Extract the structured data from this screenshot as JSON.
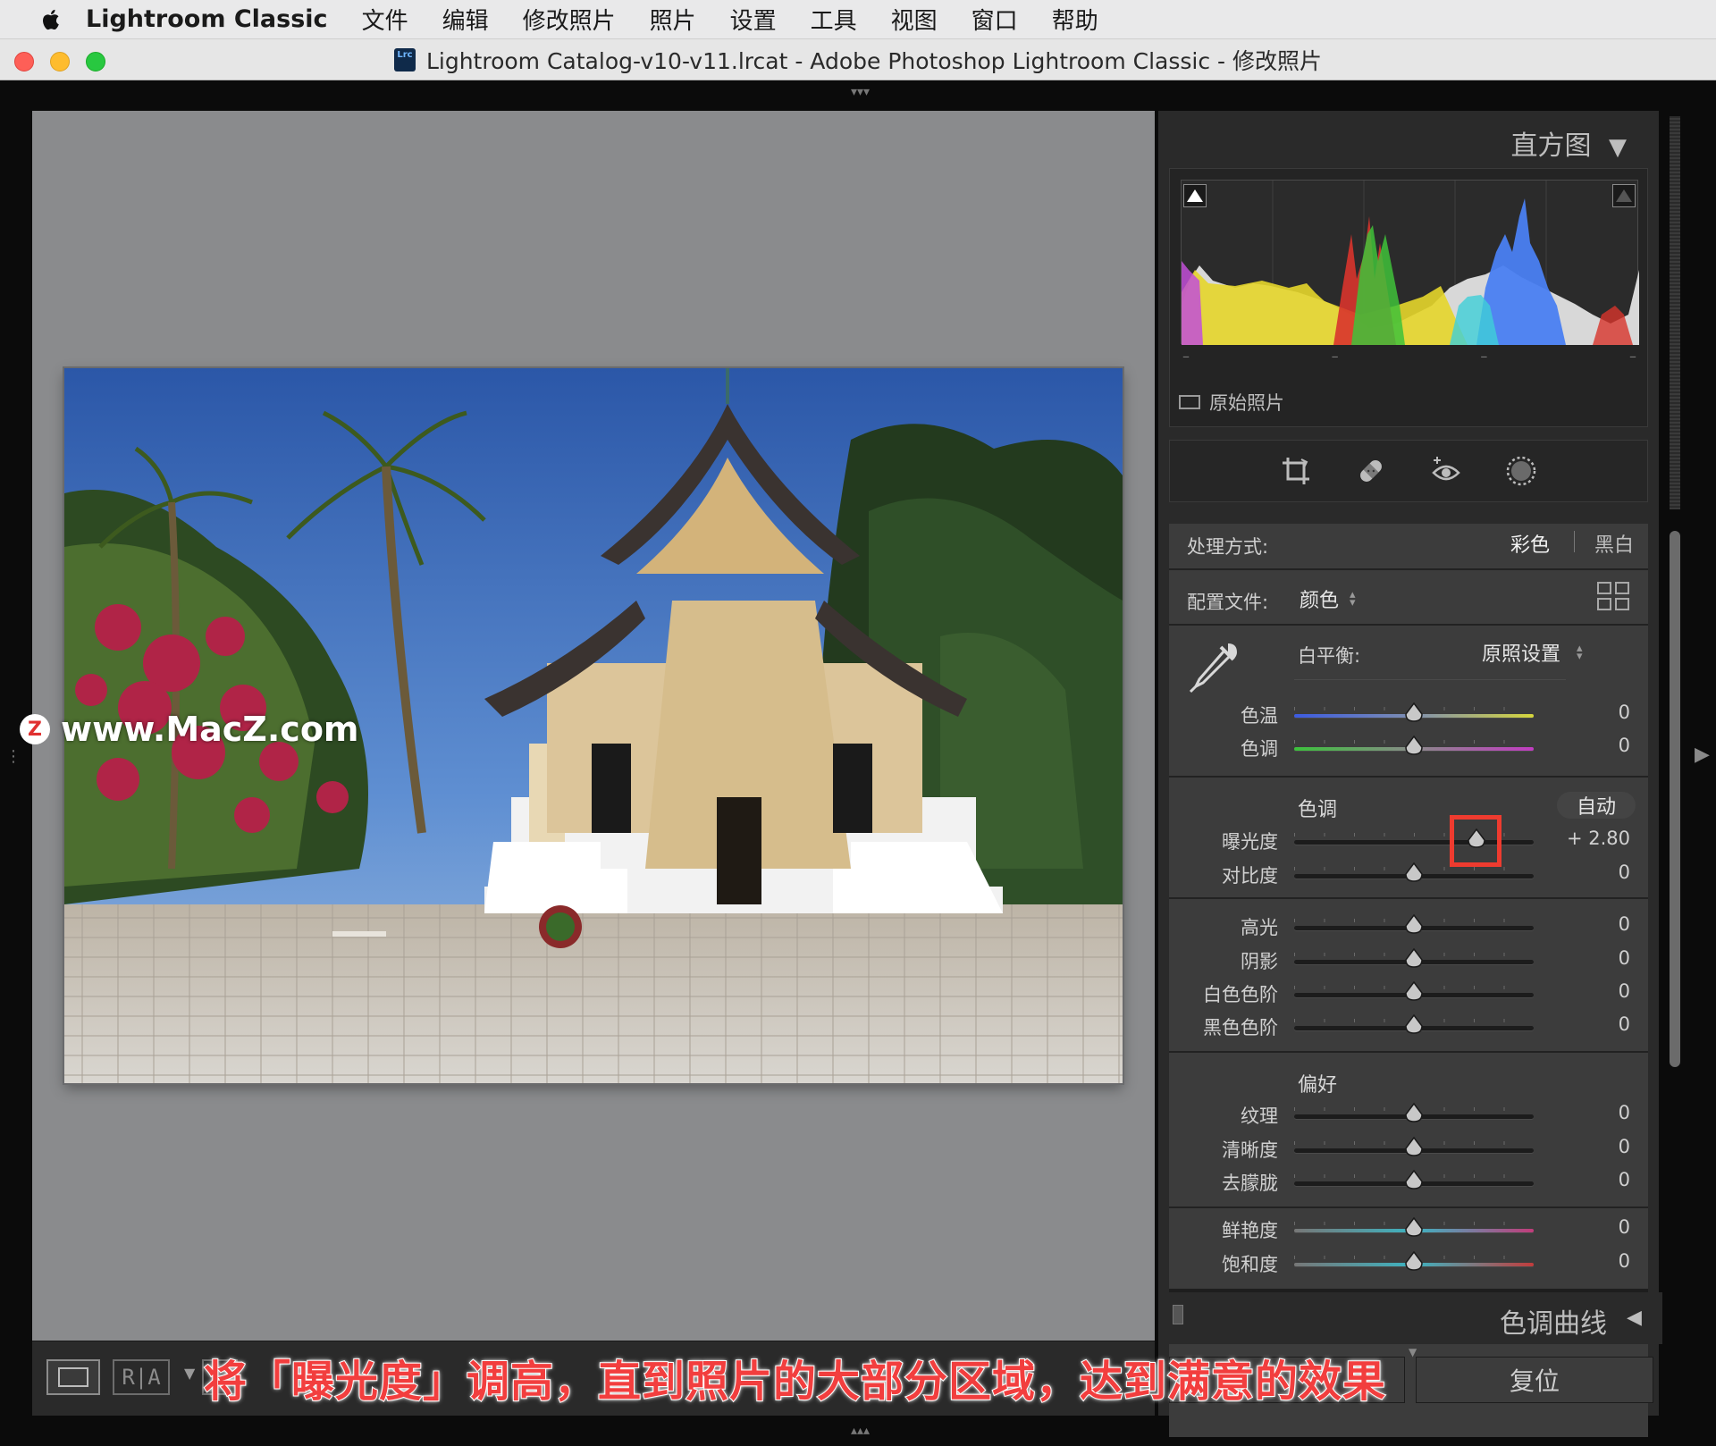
{
  "menubar": {
    "app_name": "Lightroom Classic",
    "items": [
      "文件",
      "编辑",
      "修改照片",
      "照片",
      "设置",
      "工具",
      "视图",
      "窗口",
      "帮助"
    ]
  },
  "window": {
    "title": "Lightroom Catalog-v10-v11.lrcat - Adobe Photoshop Lightroom Classic - 修改照片",
    "badge": "Lrc"
  },
  "watermark": {
    "badge": "Z",
    "text": "www.MacZ.com"
  },
  "histogram": {
    "header": "直方图",
    "original_photo_label": "原始照片"
  },
  "treatment": {
    "label": "处理方式:",
    "color": "彩色",
    "bw": "黑白"
  },
  "profile": {
    "label": "配置文件:",
    "value": "颜色"
  },
  "white_balance": {
    "label": "白平衡:",
    "value": "原照设置"
  },
  "wb_sliders": [
    {
      "label": "色温",
      "value": "0",
      "pos": 0.5
    },
    {
      "label": "色调",
      "value": "0",
      "pos": 0.5
    }
  ],
  "tone": {
    "header": "色调",
    "auto": "自动"
  },
  "tone_sliders": [
    {
      "label": "曝光度",
      "value": "+ 2.80",
      "pos": 0.76
    },
    {
      "label": "对比度",
      "value": "0",
      "pos": 0.5
    }
  ],
  "tone_sliders_2": [
    {
      "label": "高光",
      "value": "0",
      "pos": 0.5
    },
    {
      "label": "阴影",
      "value": "0",
      "pos": 0.5
    },
    {
      "label": "白色色阶",
      "value": "0",
      "pos": 0.5
    },
    {
      "label": "黑色色阶",
      "value": "0",
      "pos": 0.5
    }
  ],
  "presence": {
    "header": "偏好"
  },
  "presence_sliders": [
    {
      "label": "纹理",
      "value": "0",
      "pos": 0.5
    },
    {
      "label": "清晰度",
      "value": "0",
      "pos": 0.5
    },
    {
      "label": "去朦胧",
      "value": "0",
      "pos": 0.5
    }
  ],
  "presence_sliders_2": [
    {
      "label": "鲜艳度",
      "value": "0",
      "pos": 0.5
    },
    {
      "label": "饱和度",
      "value": "0",
      "pos": 0.5
    }
  ],
  "tone_curve": {
    "header": "色调曲线"
  },
  "buttons": {
    "reset": "复位"
  },
  "caption": "将「曝光度」调高，直到照片的大部分区域，达到满意的效果"
}
